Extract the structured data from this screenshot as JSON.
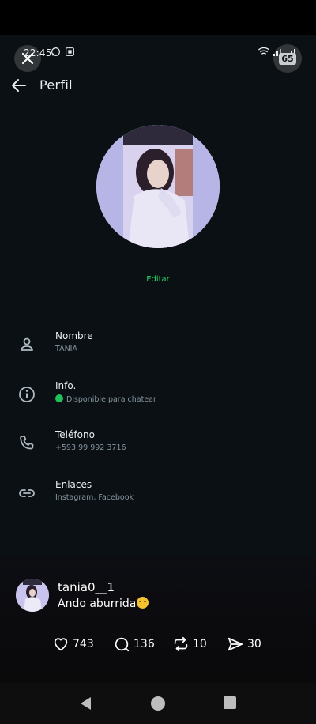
{
  "status_bar": {
    "time": "22:45",
    "battery": "65"
  },
  "header": {
    "title": "Perfil"
  },
  "profile": {
    "edit_label": "Editar"
  },
  "fields": [
    {
      "label": "Nombre",
      "value": "TANIA"
    },
    {
      "label": "Info.",
      "value": "Disponible para chatear"
    },
    {
      "label": "Teléfono",
      "value": "+593 99 992 3716"
    },
    {
      "label": "Enlaces",
      "value": "Instagram, Facebook"
    }
  ],
  "post": {
    "username": "tania0__1",
    "caption": "Ando aburrida",
    "likes": "743",
    "comments": "136",
    "reposts": "10",
    "shares": "30"
  },
  "colors": {
    "accent": "#25d366",
    "background": "#0b1014",
    "secondary_text": "#8696a0"
  }
}
